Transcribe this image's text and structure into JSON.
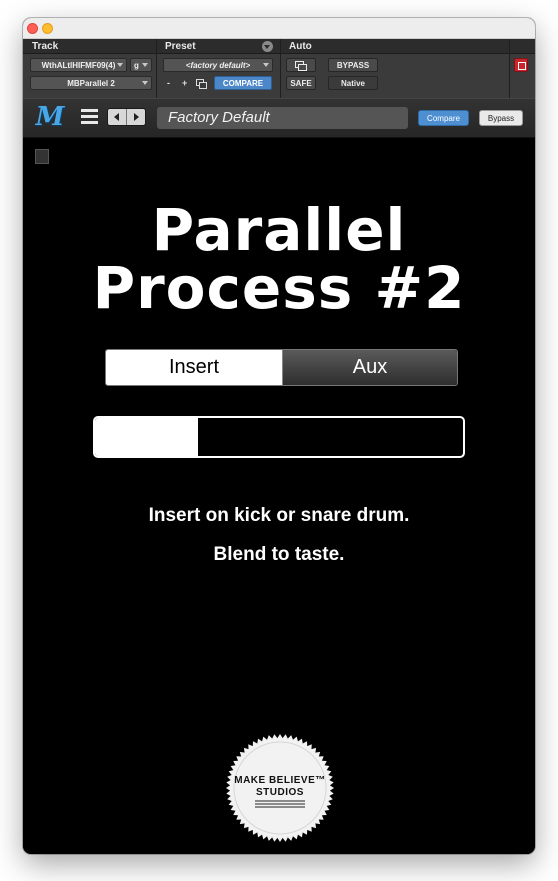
{
  "header": {
    "track_label": "Track",
    "preset_label": "Preset",
    "auto_label": "Auto",
    "track_name": "WthALtlHIFMF09(4)",
    "track_group": "g",
    "insert_name": "MBParallel 2",
    "preset_value": "<factory default>",
    "minus_label": "-",
    "plus_label": "+",
    "compare_label": "COMPARE",
    "bypass_label": "BYPASS",
    "safe_label": "SAFE",
    "native_label": "Native"
  },
  "toolbar": {
    "logo_text": "M",
    "preset_name": "Factory Default",
    "compare_label": "Compare",
    "bypass_label": "Bypass"
  },
  "plugin": {
    "title_line1": "Parallel",
    "title_line2": "Process #2",
    "mode_options": [
      "Insert",
      "Aux"
    ],
    "selected_mode": "Insert",
    "blend_level": 0.28,
    "description_line1": "Insert on kick or snare drum.",
    "description_line2": "Blend to taste.",
    "brand_line1": "MAKE BELIEVE™",
    "brand_line2": "STUDIOS"
  },
  "colors": {
    "accent_blue": "#4d8fd0",
    "bypass_red": "#c8262a",
    "background": "#000000"
  }
}
